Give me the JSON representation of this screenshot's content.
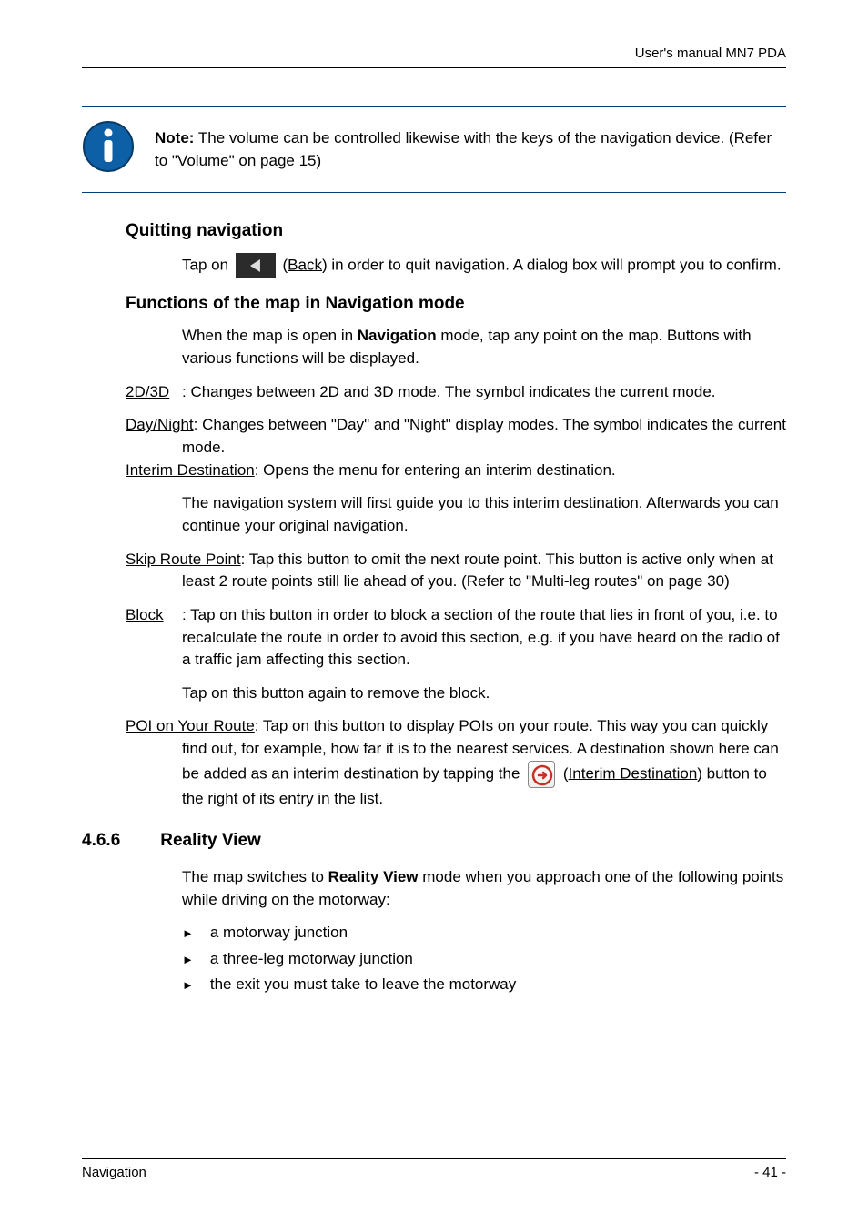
{
  "header": {
    "right": "User's manual MN7 PDA"
  },
  "note": {
    "label": "Note:",
    "text": " The volume can be controlled likewise with the keys of the navigation device. (Refer to \"Volume\" on page 15)"
  },
  "section_quit": {
    "heading": "Quitting navigation",
    "tap_prefix": "Tap on ",
    "back_label": "Back",
    "tap_suffix": ") in order to quit navigation. A dialog box will prompt you to confirm."
  },
  "section_functions": {
    "heading": "Functions of the map in Navigation mode",
    "intro1": "When the map is open in ",
    "intro_bold": "Navigation",
    "intro2": " mode, tap any point on the map. Buttons with various functions will be displayed.",
    "item_2d3d_label": "2D/3D",
    "item_2d3d_text": ": Changes between 2D and 3D mode. The symbol indicates the current mode.",
    "item_daynight_label": "Day/Night",
    "item_daynight_text": ": Changes between \"Day\" and \"Night\" display modes. The symbol indicates the current mode.",
    "item_interim_label": "Interim Destination",
    "item_interim_text": ": Opens the menu for entering an interim destination.",
    "item_interim_cont": "The navigation system will first guide you to this interim destination. Afterwards you can continue your original navigation.",
    "item_skip_label": "Skip Route Point",
    "item_skip_text": ": Tap this button to omit the next route point. This button is active only when at least 2 route points still lie ahead of you. (Refer to \"Multi-leg routes\" on page 30)",
    "item_block_label": "Block",
    "item_block_text": ": Tap on this button in order to block a section of the route that lies in front of you, i.e. to recalculate the route in order to avoid this section, e.g. if you have heard on the radio of a traffic jam affecting this section.",
    "item_block_cont": "Tap on this button again to remove the block.",
    "item_poi_label": "POI on Your Route",
    "item_poi_text": ": Tap on this button to display POIs on your route. This way you can quickly find out, for example, how far it is to the nearest services. A destination shown here can be added as an interim destination by tapping the ",
    "item_poi_btn_label": "Interim Destination",
    "item_poi_suffix": ") button to the right of its entry in the list."
  },
  "section_reality": {
    "num": "4.6.6",
    "title": "Reality View",
    "intro1": "The map switches to ",
    "intro_bold": "Reality View",
    "intro2": " mode when you approach one of the following points while driving on the motorway:",
    "bullets": [
      "a motorway junction",
      "a three-leg motorway junction",
      "the exit you must take to leave the motorway"
    ]
  },
  "footer": {
    "left": "Navigation",
    "right": "- 41 -"
  }
}
